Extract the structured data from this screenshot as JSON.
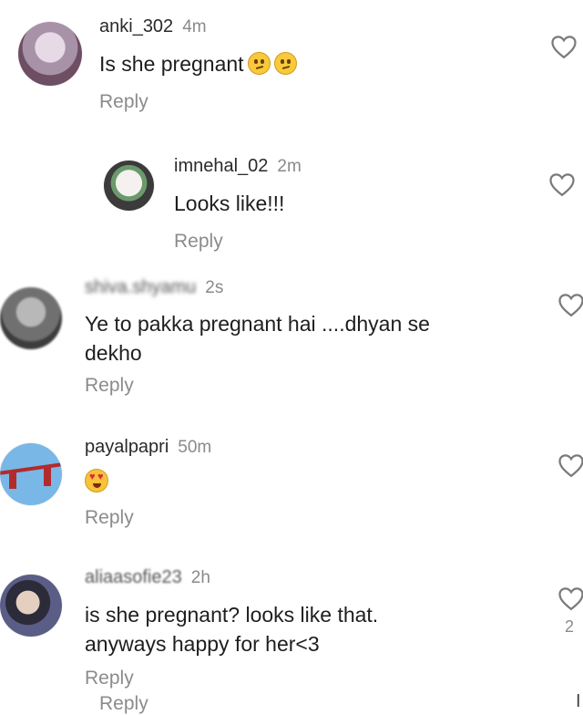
{
  "comments": [
    {
      "username": "anki_302",
      "time": "4m",
      "text": "Is she pregnant",
      "emoji": [
        "thinking-face",
        "thinking-face"
      ],
      "reply_label": "Reply",
      "avatar_colors": [
        "#c9b6c8",
        "#6d4e63"
      ]
    },
    {
      "username": "imnehal_02",
      "time": "2m",
      "text": "Looks like!!!",
      "reply_label": "Reply",
      "avatar_colors": [
        "#e9e4e1",
        "#3c3a3b"
      ]
    },
    {
      "username": "shiva.shyamu",
      "time": "2s",
      "text_line1": "Ye to pakka pregnant hai ....dhyan se",
      "text_line2": "dekho",
      "reply_label": "Reply",
      "avatar_colors": [
        "#9a9a9a",
        "#3d3d3d"
      ]
    },
    {
      "username": "payalpapri",
      "time": "50m",
      "emoji": [
        "heart-eyes-face"
      ],
      "reply_label": "Reply",
      "avatar_colors": [
        "#79b7e6",
        "#b22b2b"
      ]
    },
    {
      "username": "aliaasofie23",
      "time": "2h",
      "text_line1": "is she pregnant? looks like that.",
      "text_line2": "anyways happy for her<3",
      "reply_label": "Reply",
      "like_count": "2",
      "avatar_colors": [
        "#5a5d86",
        "#2b2b3a"
      ]
    }
  ],
  "bottom_reply_label": "Reply",
  "edge_char": "I",
  "accent_colors": {
    "text": "#1e1e1e",
    "muted": "#8b8b8b"
  }
}
